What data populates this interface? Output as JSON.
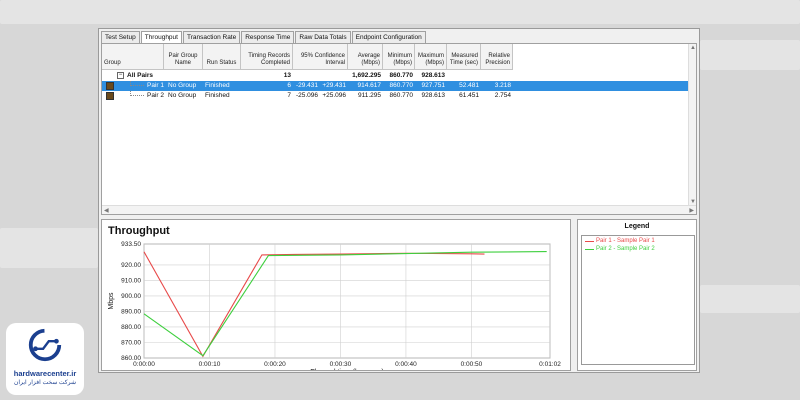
{
  "tabs": [
    {
      "label": "Test Setup",
      "active": false
    },
    {
      "label": "Throughput",
      "active": true
    },
    {
      "label": "Transaction Rate",
      "active": false
    },
    {
      "label": "Response Time",
      "active": false
    },
    {
      "label": "Raw Data Totals",
      "active": false
    },
    {
      "label": "Endpoint Configuration",
      "active": false
    }
  ],
  "grid": {
    "headers": {
      "group": "Group",
      "pair_group": "Pair Group Name",
      "run_status": "Run Status",
      "timing": "Timing Records Completed",
      "confidence": "95% Confidence Interval",
      "average": "Average (Mbps)",
      "minimum": "Minimum (Mbps)",
      "maximum": "Maximum (Mbps)",
      "measured": "Measured Time (sec)",
      "relative": "Relative Precision"
    },
    "summary": {
      "label": "All Pairs",
      "expand": "−",
      "records": "13",
      "average": "1,692.295",
      "minimum": "860.770",
      "maximum": "928.613"
    },
    "pairs": [
      {
        "name": "Pair 1",
        "group": "No Group",
        "status": "Finished",
        "records": "6",
        "ci_low": "-29.431",
        "ci_high": "+29.431",
        "average": "914.617",
        "minimum": "860.770",
        "maximum": "927.751",
        "measured": "52.481",
        "relative": "3.218",
        "selected": true
      },
      {
        "name": "Pair 2",
        "group": "No Group",
        "status": "Finished",
        "records": "7",
        "ci_low": "-25.096",
        "ci_high": "+25.096",
        "average": "911.295",
        "minimum": "860.770",
        "maximum": "928.613",
        "measured": "61.451",
        "relative": "2.754",
        "selected": false
      }
    ]
  },
  "legend": {
    "title": "Legend",
    "items": [
      {
        "label": "Pair 1 - Sample Pair 1",
        "color": "#e84a4a"
      },
      {
        "label": "Pair 2 - Sample Pair 2",
        "color": "#3ecf3e"
      }
    ]
  },
  "chart_data": {
    "type": "line",
    "title": "Throughput",
    "xlabel": "Elapsed time (h:mm:ss)",
    "ylabel": "Mbps",
    "y_ticks": [
      "933.50",
      "920.00",
      "910.00",
      "900.00",
      "890.00",
      "880.00",
      "870.00",
      "860.00"
    ],
    "x_ticks": [
      "0:00:00",
      "0:00:10",
      "0:00:20",
      "0:00:30",
      "0:00:40",
      "0:00:50",
      "0:01:02"
    ],
    "ylim": [
      860.0,
      933.5
    ],
    "xlim": [
      0,
      62
    ],
    "grid": true,
    "series": [
      {
        "name": "Pair 1 - Sample Pair 1",
        "color": "#e84a4a",
        "points": [
          [
            0,
            928.5
          ],
          [
            9,
            861.0
          ],
          [
            18,
            926.5
          ],
          [
            23,
            926.8
          ],
          [
            30,
            927.0
          ],
          [
            40,
            927.5
          ],
          [
            44,
            927.4
          ],
          [
            50,
            927.2
          ],
          [
            52,
            927.0
          ]
        ]
      },
      {
        "name": "Pair 2 - Sample Pair 2",
        "color": "#3ecf3e",
        "points": [
          [
            0,
            888.5
          ],
          [
            9,
            861.5
          ],
          [
            19,
            926.0
          ],
          [
            30,
            926.5
          ],
          [
            40,
            927.3
          ],
          [
            50,
            928.2
          ],
          [
            61.5,
            928.6
          ]
        ]
      }
    ]
  },
  "brand": {
    "name": "hardwarecenter.ir",
    "subtitle": "شرکت سخت افزار ایران",
    "color": "#1b3f8f"
  }
}
